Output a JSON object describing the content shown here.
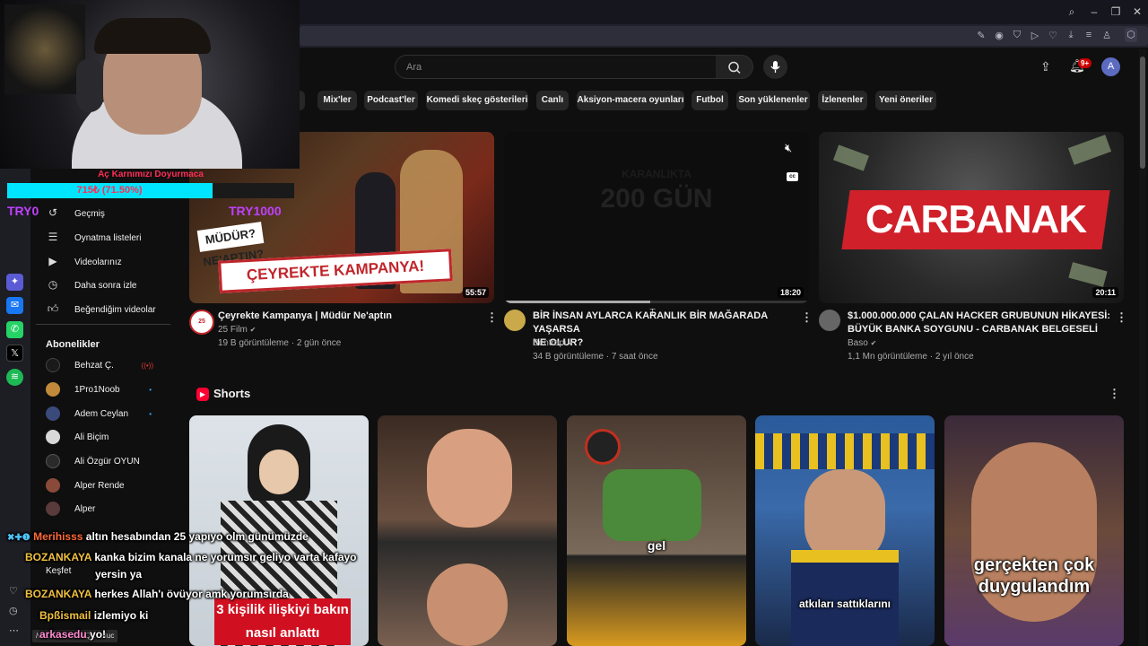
{
  "browser": {
    "status_url": "/watch?v=22wcQEOsIuc",
    "window_controls": [
      "search-icon",
      "minimize-icon",
      "restore-icon",
      "close-icon"
    ]
  },
  "youtube": {
    "search_placeholder": "Ara",
    "notification_count": "9+",
    "avatar_letter": "A",
    "chips": [
      "m",
      "Mix'ler",
      "Podcast'ler",
      "Komedi skeç gösterileri",
      "Canlı",
      "Aksiyon-macera oyunları",
      "Futbol",
      "Son yüklenenler",
      "İzlenenler",
      "Yeni öneriler"
    ]
  },
  "sidebar": {
    "items": [
      {
        "label": "Geçmiş",
        "icon": "history-icon"
      },
      {
        "label": "Oynatma listeleri",
        "icon": "playlist-icon"
      },
      {
        "label": "Videolarınız",
        "icon": "your-videos-icon"
      },
      {
        "label": "Daha sonra izle",
        "icon": "watch-later-icon"
      },
      {
        "label": "Beğendiğim videolar",
        "icon": "like-icon"
      }
    ],
    "subscriptions_title": "Abonelikler",
    "subscriptions": [
      {
        "name": "Behzat Ç.",
        "indicator": "((•))",
        "color": "#1a1a1a"
      },
      {
        "name": "1Pro1Noob",
        "indicator": "•",
        "color": "#c08a3a"
      },
      {
        "name": "Adem Ceylan",
        "indicator": "•",
        "color": "#3a4a7a"
      },
      {
        "name": "Ali Biçim",
        "indicator": "",
        "color": "#d8d8d8"
      },
      {
        "name": "Ali Özgür OYUN",
        "indicator": "",
        "color": "#2a2a2a"
      },
      {
        "name": "Alper Rende",
        "indicator": "",
        "color": "#8a4a3a"
      },
      {
        "name": "Alper",
        "indicator": "",
        "color": "#5a3a3a"
      }
    ],
    "explore_label": "Keşfet"
  },
  "videos": [
    {
      "title_lines": [
        "Çeyrekte Kampanya | Müdür Ne'aptın"
      ],
      "channel": "25 Film",
      "meta": "19 B görüntüleme · 2 gün önce",
      "duration": "55:57",
      "thumb_text": "ÇEYREKTE KAMPANYA!",
      "thumb_sub": "MÜDÜR? NE'APTIN?",
      "thumb_color": "#c0262c"
    },
    {
      "title_lines": [
        "BİR İNSAN AYLARCA KARANLIK BİR MAĞARADA YAŞARSA",
        "NE OLUR?"
      ],
      "channel": "Bentropi",
      "meta": "34 B görüntüleme · 7 saat önce",
      "duration": "18:20",
      "thumb_text": "200 GÜN",
      "thumb_sub": "KARANLIKTA",
      "thumb_color": "#111111"
    },
    {
      "title_lines": [
        "$1.000.000.000 ÇALAN HACKER GRUBUNUN HİKAYESİ:",
        "BÜYÜK BANKA SOYGUNU - CARBANAK BELGESELİ"
      ],
      "channel": "Baso",
      "meta": "1,1 Mn görüntüleme · 2 yıl önce",
      "duration": "20:11",
      "thumb_text": "CARBANAK",
      "thumb_sub": "",
      "thumb_color": "#d0202a"
    }
  ],
  "shorts": {
    "title": "Shorts",
    "items": [
      {
        "caption": "3 kişilik ilişkiyi bakın nasıl anlattı",
        "bg": "#cfd6dc"
      },
      {
        "caption": "",
        "bg": "#5a4030"
      },
      {
        "caption": "gel",
        "bg": "#6a5a4a"
      },
      {
        "caption": "atkıları sattıklarını",
        "bg": "#2a4a7a"
      },
      {
        "caption": "gerçekten çok duygulandım",
        "bg": "#6a4a3a"
      }
    ]
  },
  "stream_overlay": {
    "goal_title": "Aç Karnımızı Doyurmaca",
    "goal_progress_text": "715₺ (71.50%)",
    "goal_progress": 0.715,
    "goal_left": "TRY0",
    "goal_right": "TRY1000",
    "chat": [
      {
        "user": "Merihisss",
        "msg": "altın hesabından 25 yapıyo olm günümüzde"
      },
      {
        "user": "BOZANKAYA",
        "msg": "kanka bizim kanala ne yorumsır geliyo varta kafayo"
      },
      {
        "user": "",
        "msg": "yersin ya"
      },
      {
        "user": "BOZANKAYA",
        "msg": "herkes Allah'ı övüyor amk yorumsırda"
      },
      {
        "user": "Bpßismail",
        "msg": "izlemiyo ki"
      },
      {
        "user": "arkasedu",
        "msg": "yo!"
      }
    ]
  }
}
